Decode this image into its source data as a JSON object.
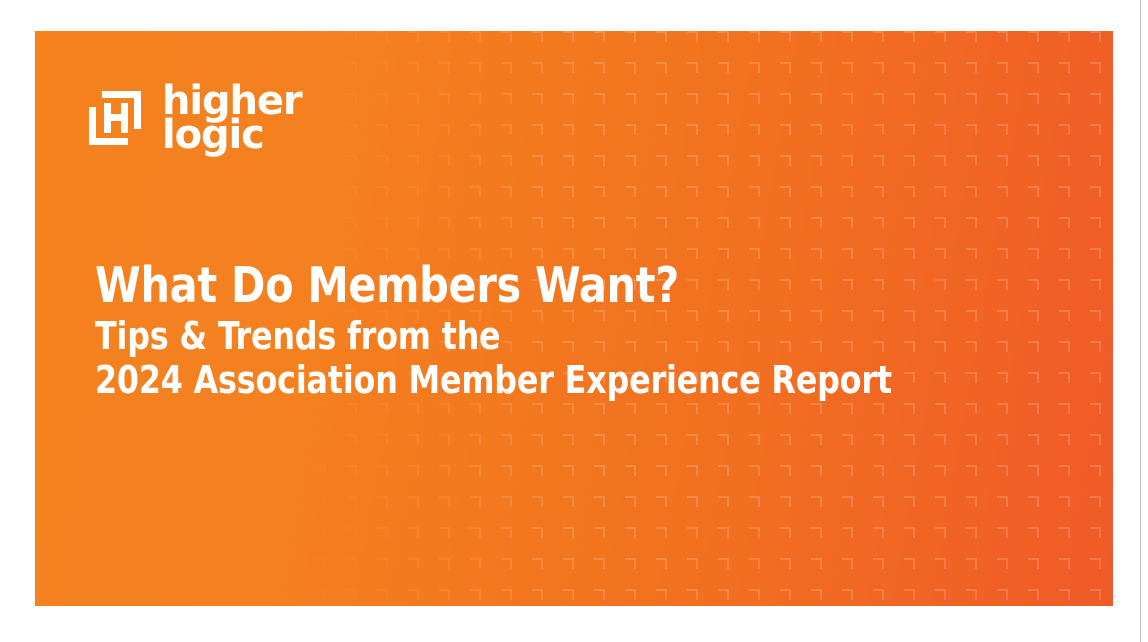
{
  "slide": {
    "background_color_left": "#F5821F",
    "background_color_right": "#F05A28",
    "text_color": "#FFFFFF",
    "pattern_name": "corner-bracket-grid"
  },
  "logo": {
    "mark_name": "higher-logic-h-mark",
    "wordmark_line1": "higher",
    "wordmark_line2": "logic"
  },
  "headline": {
    "line1": "What Do Members Want?",
    "line2": "Tips & Trends from the",
    "line3": "2024 Association Member Experience Report"
  }
}
